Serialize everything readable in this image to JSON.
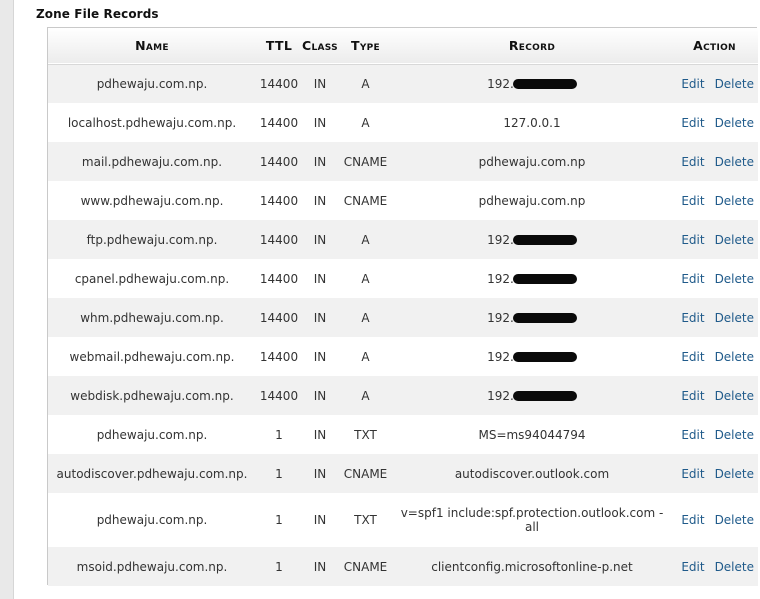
{
  "section": {
    "title": "Zone File Records"
  },
  "table": {
    "headers": {
      "name": "Name",
      "ttl": "TTL",
      "class": "Class",
      "type": "Type",
      "record": "Record",
      "action": "Action"
    },
    "action_labels": {
      "edit": "Edit",
      "delete": "Delete"
    },
    "rows": [
      {
        "name": "pdhewaju.com.np.",
        "ttl": "14400",
        "class": "IN",
        "type": "A",
        "record": "192.",
        "redacted": true
      },
      {
        "name": "localhost.pdhewaju.com.np.",
        "ttl": "14400",
        "class": "IN",
        "type": "A",
        "record": "127.0.0.1",
        "redacted": false
      },
      {
        "name": "mail.pdhewaju.com.np.",
        "ttl": "14400",
        "class": "IN",
        "type": "CNAME",
        "record": "pdhewaju.com.np",
        "redacted": false
      },
      {
        "name": "www.pdhewaju.com.np.",
        "ttl": "14400",
        "class": "IN",
        "type": "CNAME",
        "record": "pdhewaju.com.np",
        "redacted": false
      },
      {
        "name": "ftp.pdhewaju.com.np.",
        "ttl": "14400",
        "class": "IN",
        "type": "A",
        "record": "192.",
        "redacted": true
      },
      {
        "name": "cpanel.pdhewaju.com.np.",
        "ttl": "14400",
        "class": "IN",
        "type": "A",
        "record": "192.",
        "redacted": true
      },
      {
        "name": "whm.pdhewaju.com.np.",
        "ttl": "14400",
        "class": "IN",
        "type": "A",
        "record": "192.",
        "redacted": true
      },
      {
        "name": "webmail.pdhewaju.com.np.",
        "ttl": "14400",
        "class": "IN",
        "type": "A",
        "record": "192.",
        "redacted": true
      },
      {
        "name": "webdisk.pdhewaju.com.np.",
        "ttl": "14400",
        "class": "IN",
        "type": "A",
        "record": "192.",
        "redacted": true
      },
      {
        "name": "pdhewaju.com.np.",
        "ttl": "1",
        "class": "IN",
        "type": "TXT",
        "record": "MS=ms94044794",
        "redacted": false
      },
      {
        "name": "autodiscover.pdhewaju.com.np.",
        "ttl": "1",
        "class": "IN",
        "type": "CNAME",
        "record": "autodiscover.outlook.com",
        "redacted": false
      },
      {
        "name": "pdhewaju.com.np.",
        "ttl": "1",
        "class": "IN",
        "type": "TXT",
        "record": "v=spf1 include:spf.protection.outlook.com -all",
        "redacted": false,
        "tall": true
      },
      {
        "name": "msoid.pdhewaju.com.np.",
        "ttl": "1",
        "class": "IN",
        "type": "CNAME",
        "record": "clientconfig.microsoftonline-p.net",
        "redacted": false
      }
    ]
  }
}
